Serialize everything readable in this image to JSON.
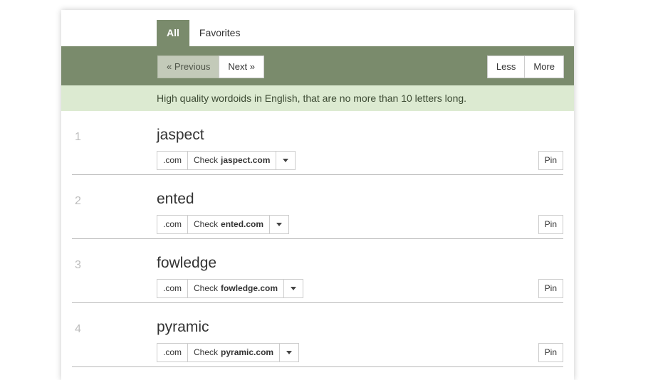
{
  "theme": {
    "navbar_green": "#7a8b6c",
    "banner_green": "#dcead1",
    "panel_bg": "#ffffff",
    "text_dark": "#333333",
    "rank_gray": "#bdbdbd"
  },
  "tabs": [
    {
      "label": "All",
      "active": true
    },
    {
      "label": "Favorites",
      "active": false
    }
  ],
  "navbar": {
    "previous_label": "« Previous",
    "next_label": "Next »",
    "less_label": "Less",
    "more_label": "More"
  },
  "banner": {
    "text": "High quality wordoids in English, that are no more than 10 letters long."
  },
  "results": [
    {
      "rank": "1",
      "word": "jaspect",
      "tld": ".com",
      "check_label": "Check",
      "domain": "jaspect.com",
      "caret": "chevron-down-icon",
      "pin_label": "Pin"
    },
    {
      "rank": "2",
      "word": "ented",
      "tld": ".com",
      "check_label": "Check",
      "domain": "ented.com",
      "caret": "chevron-down-icon",
      "pin_label": "Pin"
    },
    {
      "rank": "3",
      "word": "fowledge",
      "tld": ".com",
      "check_label": "Check",
      "domain": "fowledge.com",
      "caret": "chevron-down-icon",
      "pin_label": "Pin"
    },
    {
      "rank": "4",
      "word": "pyramic",
      "tld": ".com",
      "check_label": "Check",
      "domain": "pyramic.com",
      "caret": "chevron-down-icon",
      "pin_label": "Pin"
    }
  ]
}
